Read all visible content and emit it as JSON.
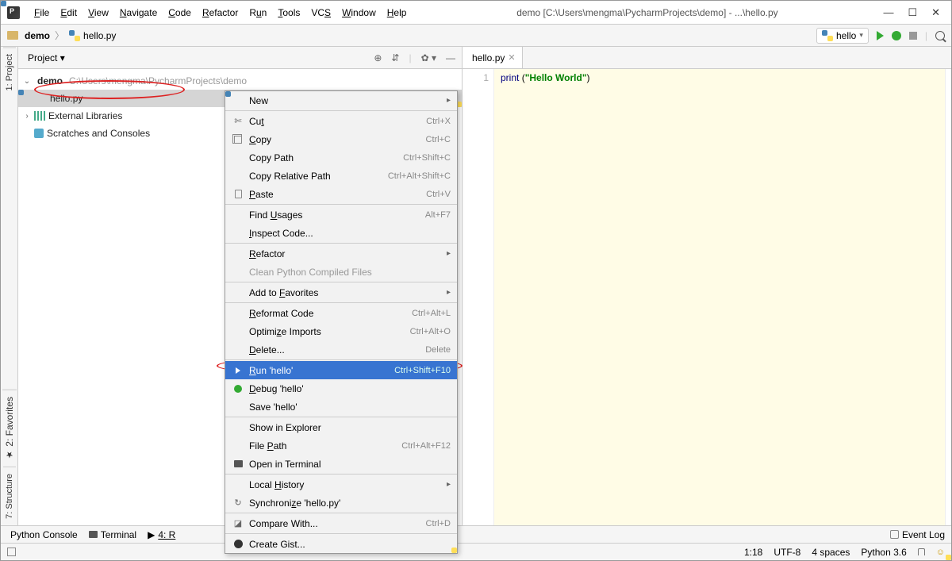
{
  "window": {
    "title": "demo [C:\\Users\\mengma\\PycharmProjects\\demo] - ...\\hello.py"
  },
  "menubar": {
    "file": "File",
    "edit": "Edit",
    "view": "View",
    "navigate": "Navigate",
    "code": "Code",
    "refactor": "Refactor",
    "run": "Run",
    "tools": "Tools",
    "vcs": "VCS",
    "window": "Window",
    "help": "Help"
  },
  "breadcrumb": {
    "root": "demo",
    "file": "hello.py"
  },
  "run_config": {
    "name": "hello"
  },
  "project_panel": {
    "title": "Project",
    "root": "demo",
    "root_path": "C:\\Users\\mengma\\PycharmProjects\\demo",
    "file": "hello.py",
    "ext_libs": "External Libraries",
    "scratches": "Scratches and Consoles"
  },
  "left_tabs": {
    "project": "1: Project",
    "favorites": "2: Favorites",
    "structure": "7: Structure"
  },
  "editor": {
    "tab": "hello.py",
    "line_no": "1",
    "code_print": "print ",
    "code_paren1": "(",
    "code_str": "\"Hello World\"",
    "code_paren2": ")"
  },
  "context_menu": [
    {
      "type": "item",
      "label": "New",
      "sub": true
    },
    {
      "type": "sep"
    },
    {
      "type": "item",
      "icon": "cut",
      "label": "Cut",
      "shortcut": "Ctrl+X",
      "mn": "t"
    },
    {
      "type": "item",
      "icon": "copy",
      "label": "Copy",
      "shortcut": "Ctrl+C",
      "mn": "C"
    },
    {
      "type": "item",
      "label": "Copy Path",
      "shortcut": "Ctrl+Shift+C"
    },
    {
      "type": "item",
      "label": "Copy Relative Path",
      "shortcut": "Ctrl+Alt+Shift+C"
    },
    {
      "type": "item",
      "icon": "paste",
      "label": "Paste",
      "shortcut": "Ctrl+V",
      "mn": "P"
    },
    {
      "type": "sep"
    },
    {
      "type": "item",
      "label": "Find Usages",
      "shortcut": "Alt+F7",
      "mn": "U"
    },
    {
      "type": "item",
      "label": "Inspect Code...",
      "mn": "I"
    },
    {
      "type": "sep"
    },
    {
      "type": "item",
      "label": "Refactor",
      "sub": true,
      "mn": "R"
    },
    {
      "type": "item",
      "label": "Clean Python Compiled Files",
      "disabled": true
    },
    {
      "type": "sep"
    },
    {
      "type": "item",
      "label": "Add to Favorites",
      "sub": true,
      "mn": "F"
    },
    {
      "type": "sep"
    },
    {
      "type": "item",
      "label": "Reformat Code",
      "shortcut": "Ctrl+Alt+L",
      "mn": "R"
    },
    {
      "type": "item",
      "label": "Optimize Imports",
      "shortcut": "Ctrl+Alt+O",
      "mn": "z"
    },
    {
      "type": "item",
      "label": "Delete...",
      "shortcut": "Delete",
      "mn": "D"
    },
    {
      "type": "sep"
    },
    {
      "type": "item",
      "icon": "play",
      "label": "Run 'hello'",
      "shortcut": "Ctrl+Shift+F10",
      "selected": true,
      "mn": "R"
    },
    {
      "type": "item",
      "icon": "bug",
      "label": "Debug 'hello'",
      "mn": "D"
    },
    {
      "type": "item",
      "icon": "python",
      "label": "Save 'hello'"
    },
    {
      "type": "sep"
    },
    {
      "type": "item",
      "label": "Show in Explorer"
    },
    {
      "type": "item",
      "label": "File Path",
      "shortcut": "Ctrl+Alt+F12",
      "mn": "P"
    },
    {
      "type": "item",
      "icon": "term",
      "label": "Open in Terminal"
    },
    {
      "type": "sep"
    },
    {
      "type": "item",
      "label": "Local History",
      "sub": true,
      "mn": "H"
    },
    {
      "type": "item",
      "icon": "sync",
      "label": "Synchronize 'hello.py'",
      "mn": "z"
    },
    {
      "type": "sep"
    },
    {
      "type": "item",
      "icon": "diff",
      "label": "Compare With...",
      "shortcut": "Ctrl+D"
    },
    {
      "type": "sep"
    },
    {
      "type": "item",
      "icon": "gh",
      "label": "Create Gist..."
    }
  ],
  "bottom_bar": {
    "python_console": "Python Console",
    "terminal": "Terminal",
    "run": "4: R",
    "event_log": "Event Log"
  },
  "status_bar": {
    "pos": "1:18",
    "enc": "UTF-8",
    "indent": "4 spaces",
    "python": "Python 3.6"
  }
}
